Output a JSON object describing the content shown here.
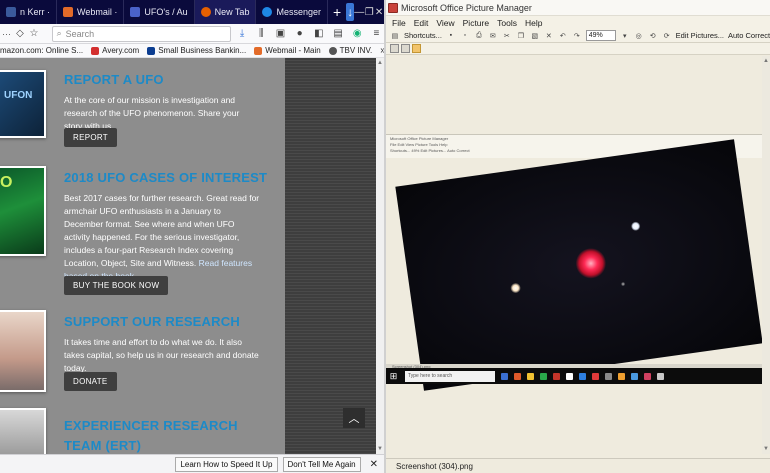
{
  "browser": {
    "tabs": [
      {
        "label": "n Kerr ·",
        "favicon_color": "#3a5a9c",
        "active": false
      },
      {
        "label": "Webmail ·",
        "favicon_color": "#e36b29",
        "active": false
      },
      {
        "label": "UFO's / Au",
        "favicon_color": "#4a62c9",
        "active": false
      },
      {
        "label": "New Tab",
        "favicon_color": "#e66000",
        "active": true
      },
      {
        "label": "Messenger",
        "favicon_color": "#1e88e5",
        "active": false
      }
    ],
    "new_tab": "+",
    "window_controls": {
      "minimize": "—",
      "restore": "❐",
      "close": "✕"
    },
    "url_partial": "···",
    "search_placeholder": "Search",
    "bookmarks": [
      {
        "label": "mazon.com: Online S...",
        "favicon_color": "#ffffff"
      },
      {
        "label": "Avery.com",
        "favicon_color": "#d32f2f"
      },
      {
        "label": "Small Business Bankin...",
        "favicon_color": "#0b3d91"
      },
      {
        "label": "Webmail - Main",
        "favicon_color": "#e36b29"
      },
      {
        "label": "TBV INV.",
        "favicon_color": "#555555"
      }
    ],
    "bookmarks_overflow": "»"
  },
  "page": {
    "sections": [
      {
        "title": "REPORT A UFO",
        "body": "At the core of our mission is investigation and research of the UFO phenomenon. Share your story with us.",
        "link": "",
        "button": "REPORT",
        "thumb_text": "UFON"
      },
      {
        "title": "2018 UFO CASES OF INTEREST",
        "body": "Best 2017 cases for further research. Great read for armchair UFO enthusiasts in a January to December format. See where and when UFO activity happened. For the serious investigator, includes a four-part Research Index covering Location, Object, Site and Witness.",
        "link": "Read features based on the book.",
        "button": "BUY THE BOOK NOW",
        "thumb_text": "O"
      },
      {
        "title": "SUPPORT OUR RESEARCH",
        "body": "It takes time and effort to do what we do. It also takes capital, so help us in our research and donate today.",
        "link": "",
        "button": "DONATE",
        "thumb_text": ""
      },
      {
        "title": "EXPERIENCER RESEARCH TEAM (ERT)",
        "body": "",
        "link": "",
        "button": "",
        "thumb_text": ""
      }
    ],
    "scroll_top_label": "︿"
  },
  "notification": {
    "learn": "Learn How to Speed It Up",
    "dismiss": "Don't Tell Me Again",
    "close": "✕"
  },
  "picture_manager": {
    "title": "Microsoft Office Picture Manager",
    "menu": [
      "File",
      "Edit",
      "View",
      "Picture",
      "Tools",
      "Help"
    ],
    "shortcuts": "Shortcuts...",
    "zoom": "49%",
    "edit_pictures": "Edit Pictures...",
    "auto_correct": "Auto Correct",
    "status_filename": "Screenshot (304).png",
    "embedded_title": "Microsoft Office Picture Manager",
    "embedded_taskbar_search": "Type here to search",
    "embedded_filename": "Screenshot (304).png"
  }
}
